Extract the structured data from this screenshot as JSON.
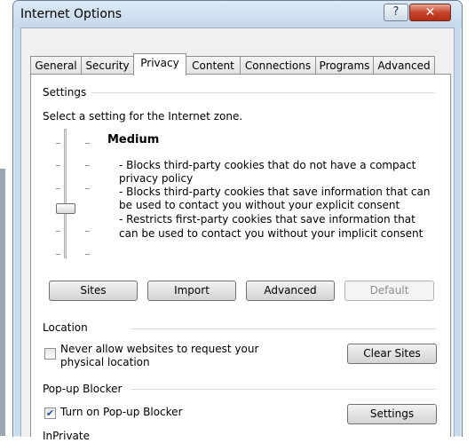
{
  "window": {
    "title": "Internet Options",
    "help_label": "?",
    "close_label": "✕"
  },
  "tabs": [
    {
      "label": "General"
    },
    {
      "label": "Security"
    },
    {
      "label": "Privacy",
      "active": true
    },
    {
      "label": "Content"
    },
    {
      "label": "Connections"
    },
    {
      "label": "Programs"
    },
    {
      "label": "Advanced"
    }
  ],
  "settings": {
    "group_label": "Settings",
    "intro": "Select a setting for the Internet zone.",
    "level_name": "Medium",
    "description_lines": [
      "- Blocks third-party cookies that do not have a compact",
      "privacy policy",
      "- Blocks third-party cookies that save information that can",
      "be used to contact you without your explicit consent",
      "- Restricts first-party cookies that save information that",
      "can be used to contact you without your implicit consent"
    ],
    "buttons": {
      "sites": "Sites",
      "import": "Import",
      "advanced": "Advanced",
      "default": "Default"
    }
  },
  "location": {
    "group_label": "Location",
    "checkbox_label_line1": "Never allow websites to request your",
    "checkbox_label_line2": "physical location",
    "checked": false,
    "clear_sites": "Clear Sites"
  },
  "popup": {
    "group_label": "Pop-up Blocker",
    "checkbox_label": "Turn on Pop-up Blocker",
    "checked": true,
    "settings": "Settings",
    "next_group_partial": "InPrivate"
  }
}
